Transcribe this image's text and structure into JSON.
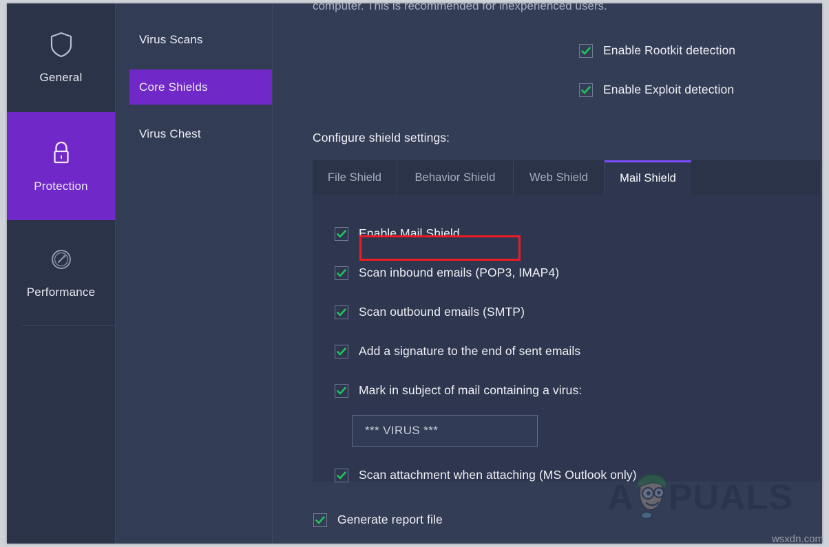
{
  "nav": {
    "items": [
      {
        "label": "General",
        "icon": "shield-icon",
        "active": false
      },
      {
        "label": "Protection",
        "icon": "lock-icon",
        "active": true
      },
      {
        "label": "Performance",
        "icon": "speedometer-icon",
        "active": false
      }
    ]
  },
  "subnav": {
    "items": [
      {
        "label": "Virus Scans",
        "active": false
      },
      {
        "label": "Core Shields",
        "active": true
      },
      {
        "label": "Virus Chest",
        "active": false
      }
    ]
  },
  "content": {
    "clipped_paragraph": "computer. This is recommended for inexperienced users.",
    "rootkit": {
      "label": "Enable Rootkit detection",
      "checked": true
    },
    "exploit": {
      "label": "Enable Exploit detection",
      "checked": true
    },
    "section_title": "Configure shield settings:",
    "report": {
      "label": "Generate report file",
      "checked": true
    }
  },
  "shield_card": {
    "tabs": [
      {
        "label": "File Shield",
        "active": false
      },
      {
        "label": "Behavior Shield",
        "active": false
      },
      {
        "label": "Web Shield",
        "active": false
      },
      {
        "label": "Mail Shield",
        "active": true
      }
    ],
    "options": [
      {
        "label": "Enable Mail Shield",
        "checked": true,
        "highlighted": true
      },
      {
        "label": "Scan inbound emails (POP3, IMAP4)",
        "checked": true,
        "highlighted": false
      },
      {
        "label": "Scan outbound emails (SMTP)",
        "checked": true,
        "highlighted": false
      },
      {
        "label": "Add a signature to the end of sent emails",
        "checked": true,
        "highlighted": false
      },
      {
        "label": "Mark in subject of mail containing a virus:",
        "checked": true,
        "highlighted": false
      },
      {
        "label": "Scan attachment when attaching (MS Outlook only)",
        "checked": true,
        "highlighted": false
      }
    ],
    "virus_subject_input": {
      "value": "*** VIRUS ***",
      "placeholder": "*** VIRUS ***"
    }
  },
  "watermark": {
    "text_left": "A",
    "text_right": "PUALS",
    "site_stamp": "wsxdn.com"
  },
  "colors": {
    "accent_purple": "#7128c8",
    "tab_underline": "#7c4dff",
    "check_green": "#21c35b",
    "highlight_red": "#ec1c24",
    "panel_bg": "#2e374f",
    "content_bg": "#343d56"
  }
}
